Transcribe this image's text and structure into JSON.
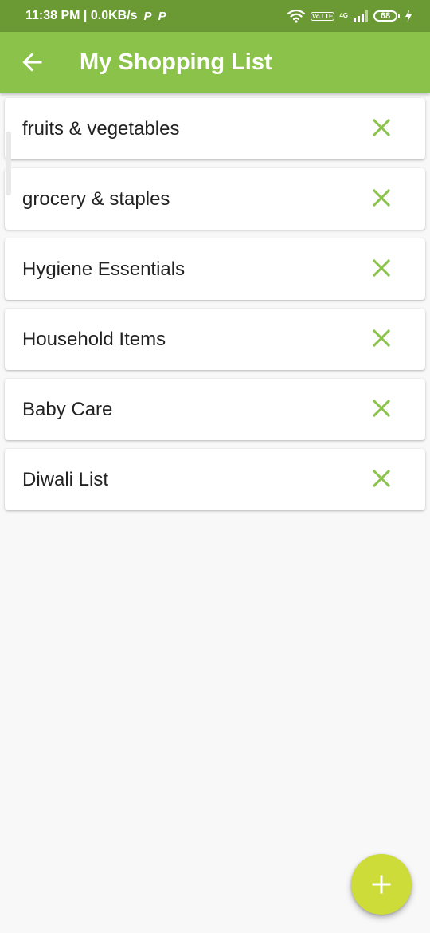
{
  "status_bar": {
    "time_speed": "11:38 PM | 0.0KB/s",
    "p_icon": "P",
    "volte": "Vo LTE",
    "network": "4G",
    "battery": "68"
  },
  "app_bar": {
    "title": "My Shopping List"
  },
  "lists": [
    {
      "label": "fruits & vegetables"
    },
    {
      "label": "grocery & staples"
    },
    {
      "label": "Hygiene Essentials"
    },
    {
      "label": "Household Items"
    },
    {
      "label": "Baby Care"
    },
    {
      "label": "Diwali List"
    }
  ],
  "colors": {
    "status_bar": "#6b9a35",
    "app_bar": "#8bc34a",
    "remove_icon": "#8bc34a",
    "fab": "#cddc39",
    "background": "#f8f8f8"
  },
  "icons": {
    "back": "arrow-back-icon",
    "remove": "close-icon",
    "fab": "plus-icon"
  }
}
